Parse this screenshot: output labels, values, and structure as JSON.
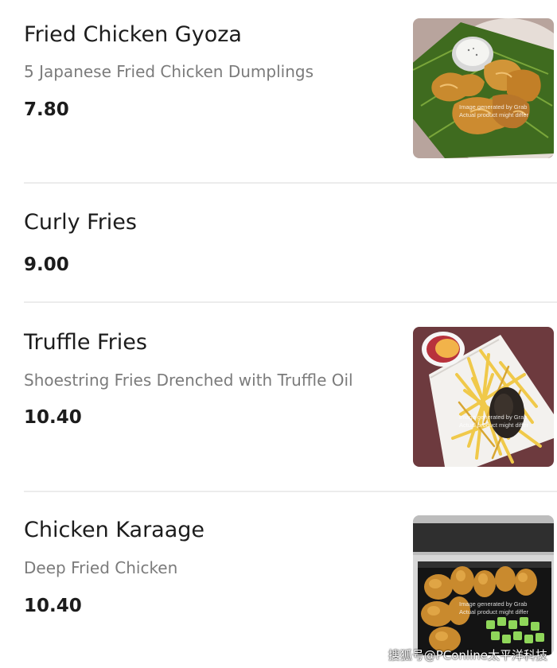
{
  "menu": {
    "items": [
      {
        "name": "Fried Chicken Gyoza",
        "description": "5 Japanese Fried Chicken Dumplings",
        "price": "7.80",
        "image_caption_line1": "Image generated by Grab",
        "image_caption_line2": "Actual product might differ"
      },
      {
        "name": "Curly Fries",
        "description": "",
        "price": "9.00"
      },
      {
        "name": "Truffle Fries",
        "description": "Shoestring Fries Drenched with Truffle Oil",
        "price": "10.40",
        "image_caption_line1": "Image generated by Grab",
        "image_caption_line2": "Actual product might differ"
      },
      {
        "name": "Chicken Karaage",
        "description": "Deep Fried Chicken",
        "price": "10.40",
        "image_caption_line1": "Image generated by Grab",
        "image_caption_line2": "Actual product might differ"
      }
    ]
  },
  "watermark": "搜狐号@PConline太平洋科技",
  "colors": {
    "text_primary": "#1c1c1c",
    "text_secondary": "#7b7b7b",
    "divider": "#ececec"
  }
}
